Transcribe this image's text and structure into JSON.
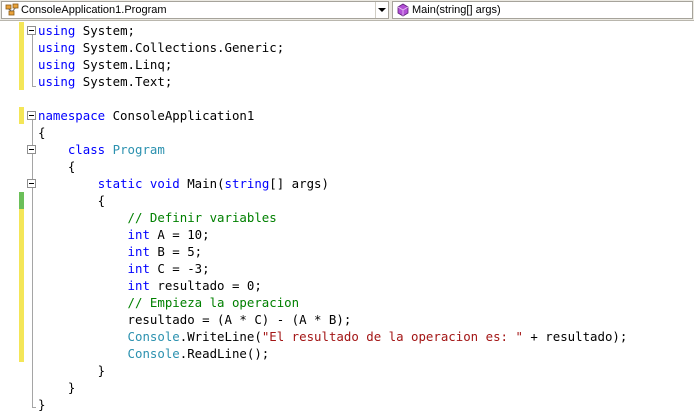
{
  "navbar": {
    "type_combo": {
      "value": "ConsoleApplication1.Program",
      "icon": "class-icon"
    },
    "member_combo": {
      "value": "Main(string[] args)",
      "icon": "method-icon"
    }
  },
  "colors": {
    "keyword": "#0000ff",
    "type": "#2b91af",
    "comment": "#008000",
    "string": "#a31515",
    "change_unsaved": "#f4e658",
    "change_saved": "#6bbf59"
  },
  "code": [
    [
      "using",
      " System;"
    ],
    [
      "using",
      " System.Collections.Generic;"
    ],
    [
      "using",
      " System.Linq;"
    ],
    [
      "using",
      " System.Text;"
    ],
    [
      ""
    ],
    [
      "namespace",
      " ConsoleApplication1"
    ],
    [
      "{"
    ],
    [
      "    ",
      "class",
      " ",
      "Program"
    ],
    [
      "    {"
    ],
    [
      "        ",
      "static",
      " ",
      "void",
      " Main(",
      "string",
      "[] args)"
    ],
    [
      "        {"
    ],
    [
      "            ",
      "// Definir variables"
    ],
    [
      "            ",
      "int",
      " A = 10;"
    ],
    [
      "            ",
      "int",
      " B = 5;"
    ],
    [
      "            ",
      "int",
      " C = -3;"
    ],
    [
      "            ",
      "int",
      " resultado = 0;"
    ],
    [
      "            ",
      "// Empieza la operacion"
    ],
    [
      "            resultado = (A * C) - (A * B);"
    ],
    [
      "            ",
      "Console",
      ".WriteLine(",
      "\"El resultado de la operacion es: \"",
      " + resultado);"
    ],
    [
      "            ",
      "Console",
      ".ReadLine();"
    ],
    [
      "        }"
    ],
    [
      "    }"
    ],
    [
      "}"
    ]
  ]
}
